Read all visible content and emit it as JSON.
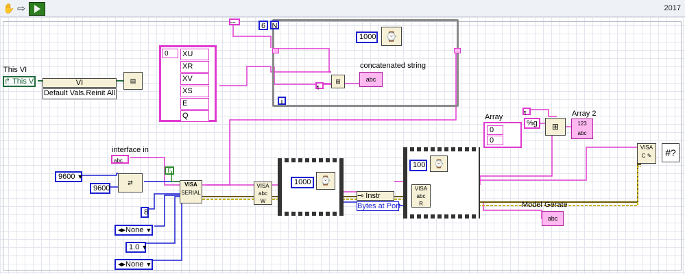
{
  "toolbar": {
    "hand_icon": "hand-tool-icon",
    "arrow_icon": "run-arrow-icon",
    "run_icon": "run-icon"
  },
  "version": "2017",
  "labels": {
    "this_vi": "This VI",
    "this_vi_ref": "This VI",
    "vi_node": "VI",
    "invoke_method": "Default Vals.Reinit All",
    "interface_in": "interface in",
    "concatenated_string": "concatenated string",
    "array": "Array",
    "array2": "Array 2",
    "model_gerate": "Model Gerate",
    "instr": "Instr",
    "bytes_at_port": "Bytes at Port",
    "visa_serial": "VISA",
    "serial_small": "SERIAL"
  },
  "constants": {
    "baud_dd": "9600",
    "baud": "9600",
    "data_bits": "8",
    "parity": "None",
    "stop_bits": "1.0",
    "flow_control": "None",
    "bool_false": "F",
    "loop_count": "6",
    "loop_count_label": "N",
    "loop_index": "i",
    "array_index": "0",
    "wait1": "1000",
    "wait2": "1000",
    "wait3": "100",
    "format": "%g",
    "array_idx_a": "0",
    "array_val_a": "0"
  },
  "string_array": [
    "XU",
    "XR",
    "XV",
    "XS",
    "E",
    "Q"
  ],
  "colors": {
    "string_wire": "#e03ad0",
    "int_wire": "#1a1fd0",
    "visa_wire": "#6b5a00",
    "error_wire": "#c8b400"
  }
}
